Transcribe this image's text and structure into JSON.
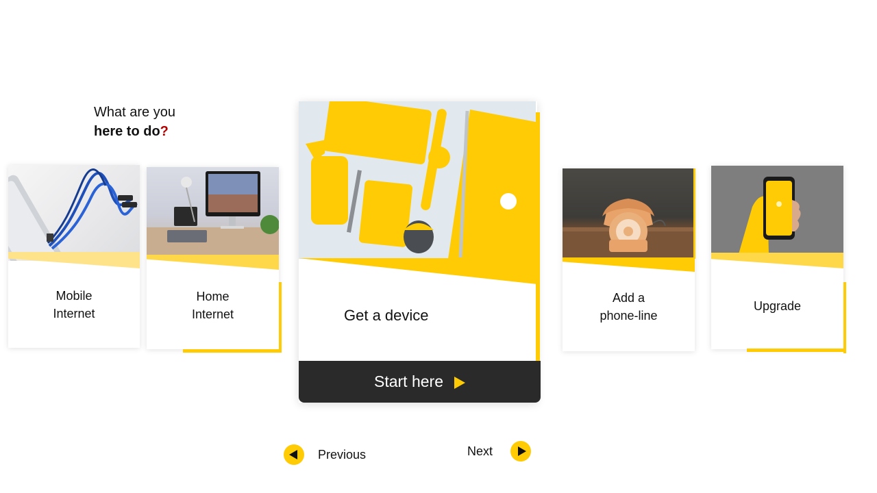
{
  "header": {
    "line1": "What are you",
    "line2_bold": "here to do",
    "line2_mark": "?"
  },
  "colors": {
    "accent": "#FFCB05",
    "accent_light": "#FFE38A",
    "dark_button": "#2a2a2a",
    "question_mark": "#b00000"
  },
  "cards": [
    {
      "label_line1": "Mobile",
      "label_line2": "Internet",
      "image": "power-bank-with-usb-cables-photo"
    },
    {
      "label_line1": "Home",
      "label_line2": "Internet",
      "image": "desk-with-imac-and-tablet-photo"
    },
    {
      "label": "Get a device",
      "image": "yellow-devices-flatlay-photo",
      "cta_label": "Start here",
      "cta_icon": "play-arrow-icon"
    },
    {
      "label_line1": "Add a",
      "label_line2": "phone-line",
      "image": "rotary-telephone-photo"
    },
    {
      "label": "Upgrade",
      "image": "hand-holding-smartphone-photo"
    }
  ],
  "navigation": {
    "previous_label": "Previous",
    "next_label": "Next",
    "previous_icon": "arrow-left-icon",
    "next_icon": "arrow-right-icon"
  }
}
